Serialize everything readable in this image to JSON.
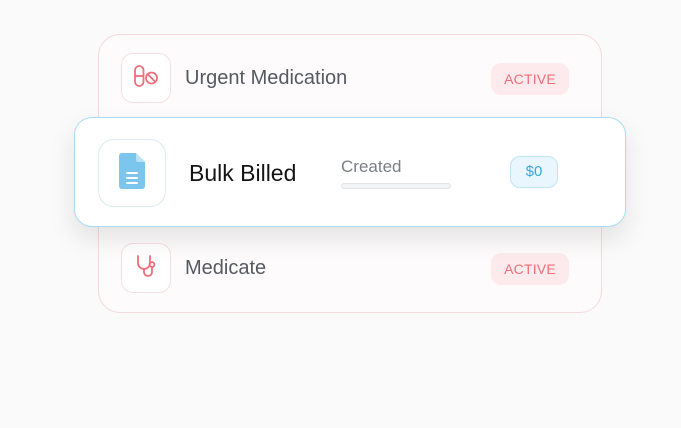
{
  "items": [
    {
      "label": "Urgent Medication",
      "status": "ACTIVE",
      "icon": "pill-prohibited-icon"
    },
    {
      "label": "Medicate",
      "status": "ACTIVE",
      "icon": "stethoscope-icon"
    }
  ],
  "featured": {
    "title": "Bulk Billed",
    "status_label": "Created",
    "progress": 0,
    "price": "$0",
    "icon": "document-icon"
  },
  "colors": {
    "active_badge_bg": "#fdeaec",
    "active_badge_text": "#ee6f7a",
    "accent_blue": "#3aa6dd",
    "icon_red": "#ee6f7a",
    "document_blue": "#7cc6ee"
  }
}
